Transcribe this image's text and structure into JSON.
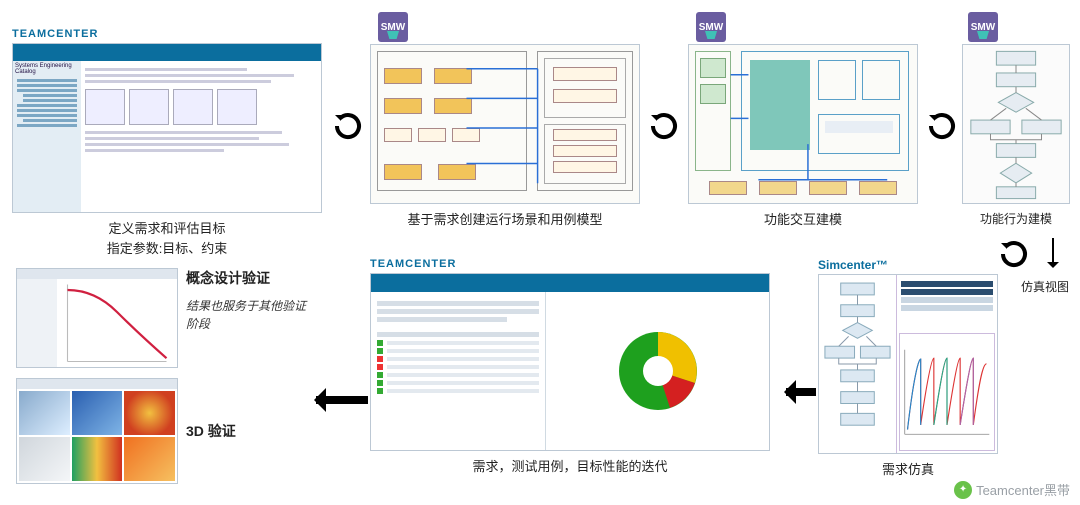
{
  "apps": {
    "teamcenter": "TEAMCENTER",
    "smw": "SMW",
    "simcenter": "Simcenter™"
  },
  "top_row": {
    "stage1": {
      "caption_line1": "定义需求和评估目标",
      "caption_line2": "指定参数:目标、约束"
    },
    "stage2": {
      "caption": "基于需求创建运行场景和用例模型"
    },
    "stage3": {
      "caption": "功能交互建模"
    },
    "stage4": {
      "caption": "功能行为建模"
    }
  },
  "right_branch": {
    "caption": "仿真视图"
  },
  "bottom_row": {
    "stage5": {
      "caption": "需求仿真"
    },
    "stage6": {
      "caption": "需求，测试用例，目标性能的迭代"
    },
    "stage7a": {
      "title": "概念设计验证",
      "note": "结果也服务于其他验证阶段"
    },
    "stage7b": {
      "title": "3D 验证"
    }
  },
  "teamcenter_catalog_title": "Systems Engineering Catalog",
  "watermark": "Teamcenter黑带"
}
